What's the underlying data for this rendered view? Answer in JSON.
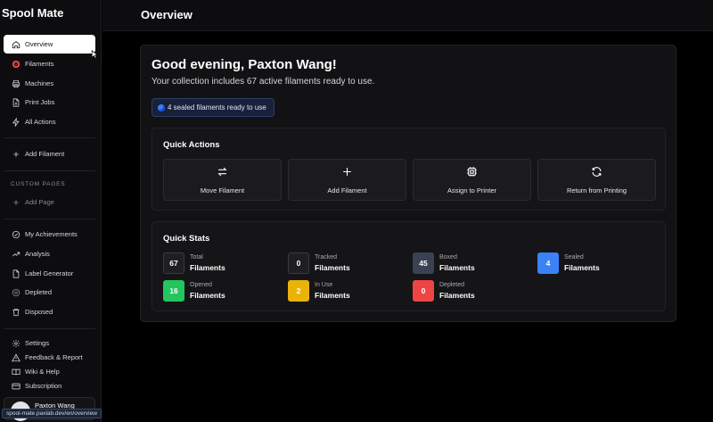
{
  "brand": "Spool Mate",
  "header": {
    "title": "Overview"
  },
  "sidebar": {
    "nav": [
      {
        "label": "Overview",
        "icon": "home-icon"
      },
      {
        "label": "Filaments",
        "icon": "spool-icon"
      },
      {
        "label": "Machines",
        "icon": "printer-icon"
      },
      {
        "label": "Print Jobs",
        "icon": "file-icon"
      },
      {
        "label": "All Actions",
        "icon": "bolt-icon"
      }
    ],
    "add_filament": "Add Filament",
    "custom_pages_label": "CUSTOM PAGES",
    "add_page": "Add Page",
    "extra": [
      {
        "label": "My Achievements",
        "icon": "check-circle-icon"
      },
      {
        "label": "Analysis",
        "icon": "trend-icon"
      },
      {
        "label": "Label Generator",
        "icon": "file-icon"
      },
      {
        "label": "Depleted",
        "icon": "depleted-icon"
      },
      {
        "label": "Disposed",
        "icon": "trash-icon"
      }
    ],
    "footer": [
      {
        "label": "Settings",
        "icon": "gear-icon"
      },
      {
        "label": "Feedback & Report",
        "icon": "warning-icon"
      },
      {
        "label": "Wiki & Help",
        "icon": "book-icon"
      },
      {
        "label": "Subscription",
        "icon": "card-icon"
      }
    ],
    "user_name": "Paxton Wang",
    "status_url": "spool-mate.paxlab.dev/en/overview"
  },
  "main": {
    "greeting": "Good evening, Paxton Wang!",
    "subtitle": "Your collection includes 67 active filaments ready to use.",
    "sealed_badge": "4 sealed filaments ready to use",
    "quick_actions": {
      "title": "Quick Actions",
      "items": [
        {
          "label": "Move Filament",
          "icon": "swap-icon"
        },
        {
          "label": "Add Filament",
          "icon": "plus-icon"
        },
        {
          "label": "Assign to Printer",
          "icon": "chip-icon"
        },
        {
          "label": "Return from Printing",
          "icon": "refresh-icon"
        }
      ]
    },
    "quick_stats": {
      "title": "Quick Stats",
      "items": [
        {
          "value": "67",
          "label": "Total",
          "sub": "Filaments",
          "color": "#1f1f23"
        },
        {
          "value": "0",
          "label": "Tracked",
          "sub": "Filaments",
          "color": "#1f1f23"
        },
        {
          "value": "45",
          "label": "Boxed",
          "sub": "Filaments",
          "color": "#3a4152"
        },
        {
          "value": "4",
          "label": "Sealed",
          "sub": "Filaments",
          "color": "#3b82f6"
        },
        {
          "value": "16",
          "label": "Opened",
          "sub": "Filaments",
          "color": "#22c55e"
        },
        {
          "value": "2",
          "label": "In Use",
          "sub": "Filaments",
          "color": "#eab308"
        },
        {
          "value": "0",
          "label": "Depleted",
          "sub": "Filaments",
          "color": "#ef4444"
        }
      ]
    }
  }
}
